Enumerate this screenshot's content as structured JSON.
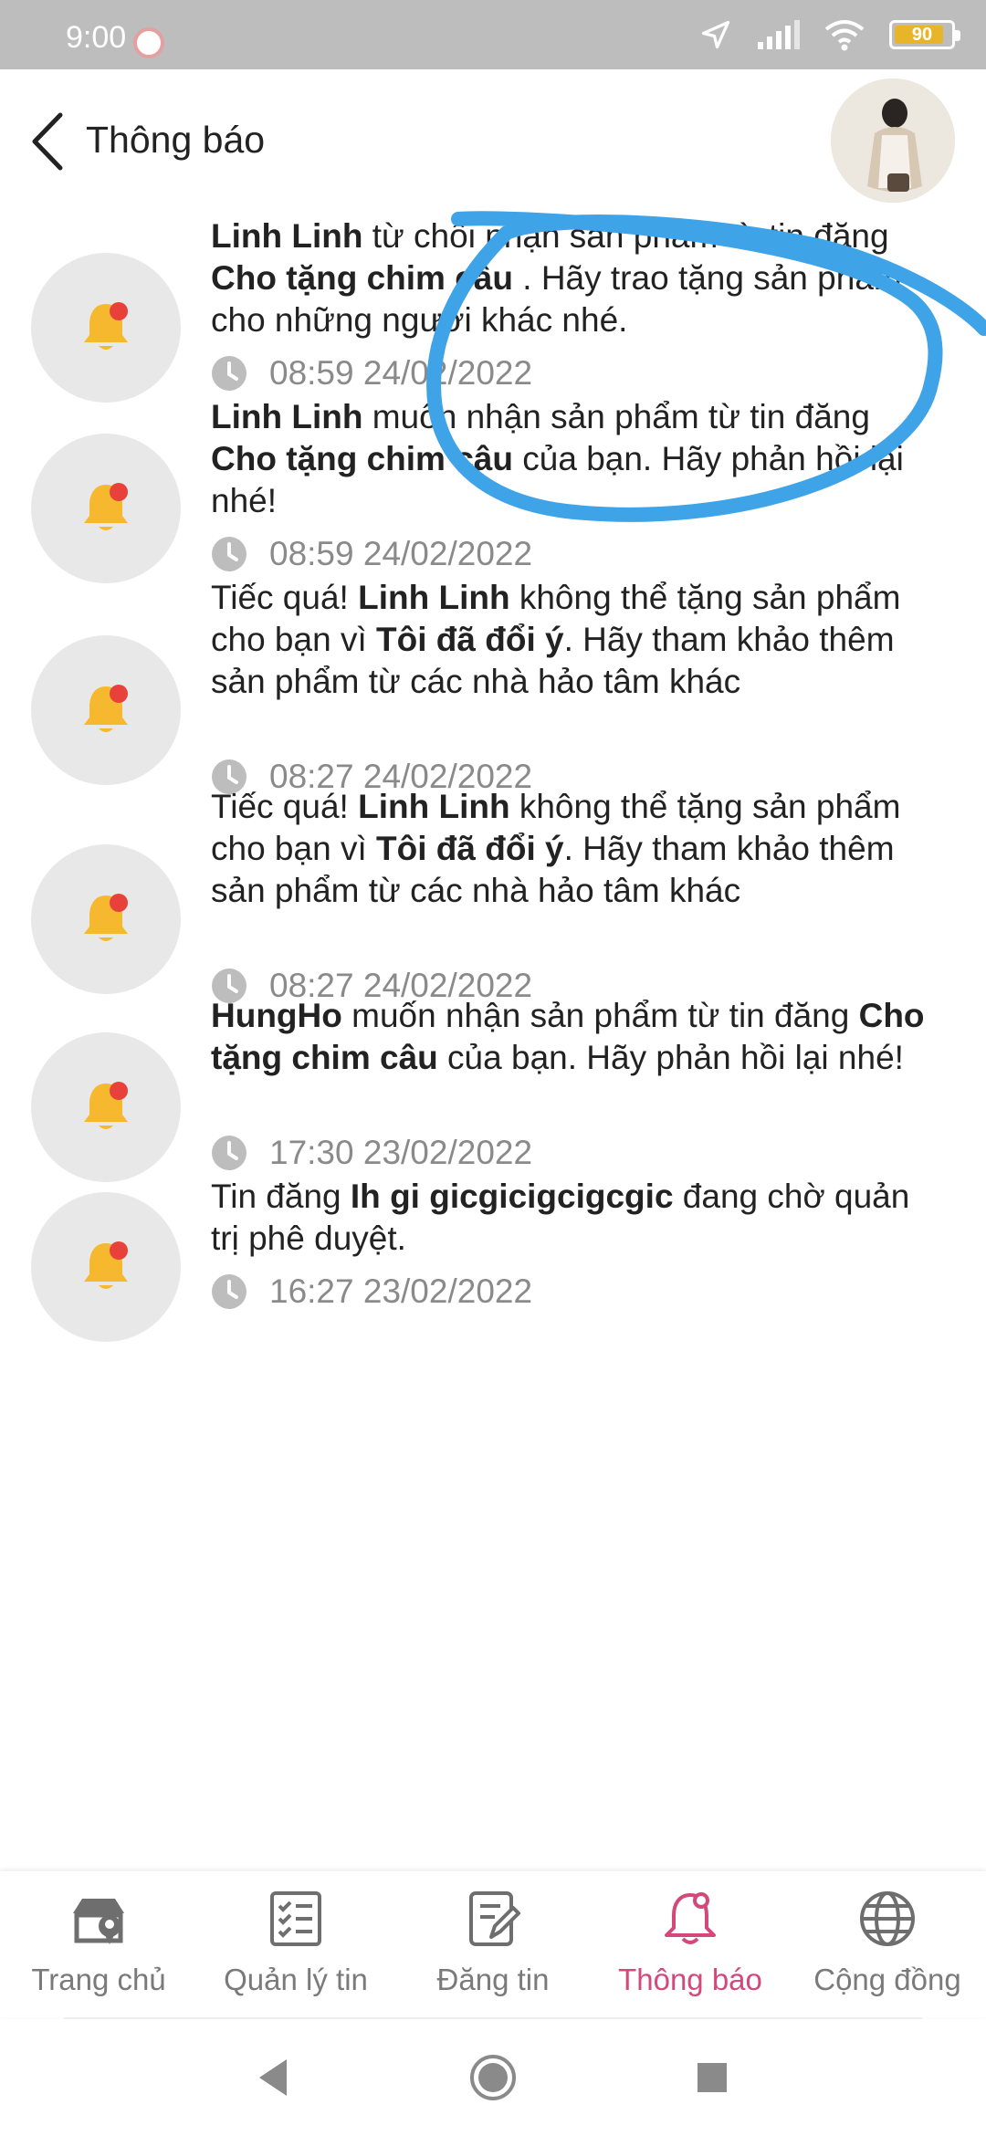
{
  "status_bar": {
    "time": "9:00",
    "battery_level": "90",
    "battery_fraction": 0.9,
    "battery_color": "#e8b42a"
  },
  "header": {
    "back_icon": "chevron-left-icon",
    "title": "Thông báo"
  },
  "notifications": [
    {
      "parts": [
        {
          "text": "Linh Linh",
          "bold": true
        },
        {
          "text": " từ chối nhận sản phẩm từ tin đăng ",
          "bold": false
        },
        {
          "text": "Cho tặng chim câu",
          "bold": true
        },
        {
          "text": " . Hãy trao tặng sản phẩm cho những người khác nhé.",
          "bold": false
        }
      ],
      "time": "08:59 24/02/2022"
    },
    {
      "parts": [
        {
          "text": "Linh Linh",
          "bold": true
        },
        {
          "text": " muốn nhận sản phẩm từ tin đăng ",
          "bold": false
        },
        {
          "text": "Cho tặng chim câu",
          "bold": true
        },
        {
          "text": "  của bạn. Hãy phản hồi lại nhé!",
          "bold": false
        }
      ],
      "time": "08:59 24/02/2022"
    },
    {
      "parts": [
        {
          "text": "Tiếc quá! ",
          "bold": false
        },
        {
          "text": "Linh Linh",
          "bold": true
        },
        {
          "text": " không thể tặng sản phẩm cho bạn vì ",
          "bold": false
        },
        {
          "text": "Tôi đã đổi ý",
          "bold": true
        },
        {
          "text": ". Hãy tham khảo thêm sản phẩm từ các nhà hảo tâm khác",
          "bold": false
        }
      ],
      "time": "08:27 24/02/2022"
    },
    {
      "parts": [
        {
          "text": "Tiếc quá! ",
          "bold": false
        },
        {
          "text": "Linh Linh",
          "bold": true
        },
        {
          "text": " không thể tặng sản phẩm cho bạn vì ",
          "bold": false
        },
        {
          "text": "Tôi đã đổi ý",
          "bold": true
        },
        {
          "text": ". Hãy tham khảo thêm sản phẩm từ các nhà hảo tâm khác",
          "bold": false
        }
      ],
      "time": "08:27 24/02/2022"
    },
    {
      "parts": [
        {
          "text": "HungHo",
          "bold": true
        },
        {
          "text": " muốn nhận sản phẩm từ tin đăng ",
          "bold": false
        },
        {
          "text": "Cho tặng chim câu",
          "bold": true
        },
        {
          "text": "  của bạn. Hãy phản hồi lại nhé!",
          "bold": false
        }
      ],
      "time": "17:30 23/02/2022"
    },
    {
      "parts": [
        {
          "text": "Tin đăng ",
          "bold": false
        },
        {
          "text": "Ih gi gicgicigcigcgic",
          "bold": true
        },
        {
          "text": " đang chờ quản trị phê duyệt.",
          "bold": false
        }
      ],
      "time": "16:27 23/02/2022"
    }
  ],
  "colors": {
    "bell": "#f5b82e",
    "badge": "#e8413b",
    "icon_bg": "#e8e8e8",
    "active": "#d2497a",
    "annotation": "#3fa3e8"
  },
  "bottom_nav": [
    {
      "label": "Trang chủ",
      "icon": "home-store-icon",
      "active": false
    },
    {
      "label": "Quản lý tin",
      "icon": "checklist-icon",
      "active": false
    },
    {
      "label": "Đăng tin",
      "icon": "edit-document-icon",
      "active": false
    },
    {
      "label": "Thông báo",
      "icon": "bell-icon",
      "active": true
    },
    {
      "label": "Cộng đồng",
      "icon": "globe-icon",
      "active": false
    }
  ]
}
